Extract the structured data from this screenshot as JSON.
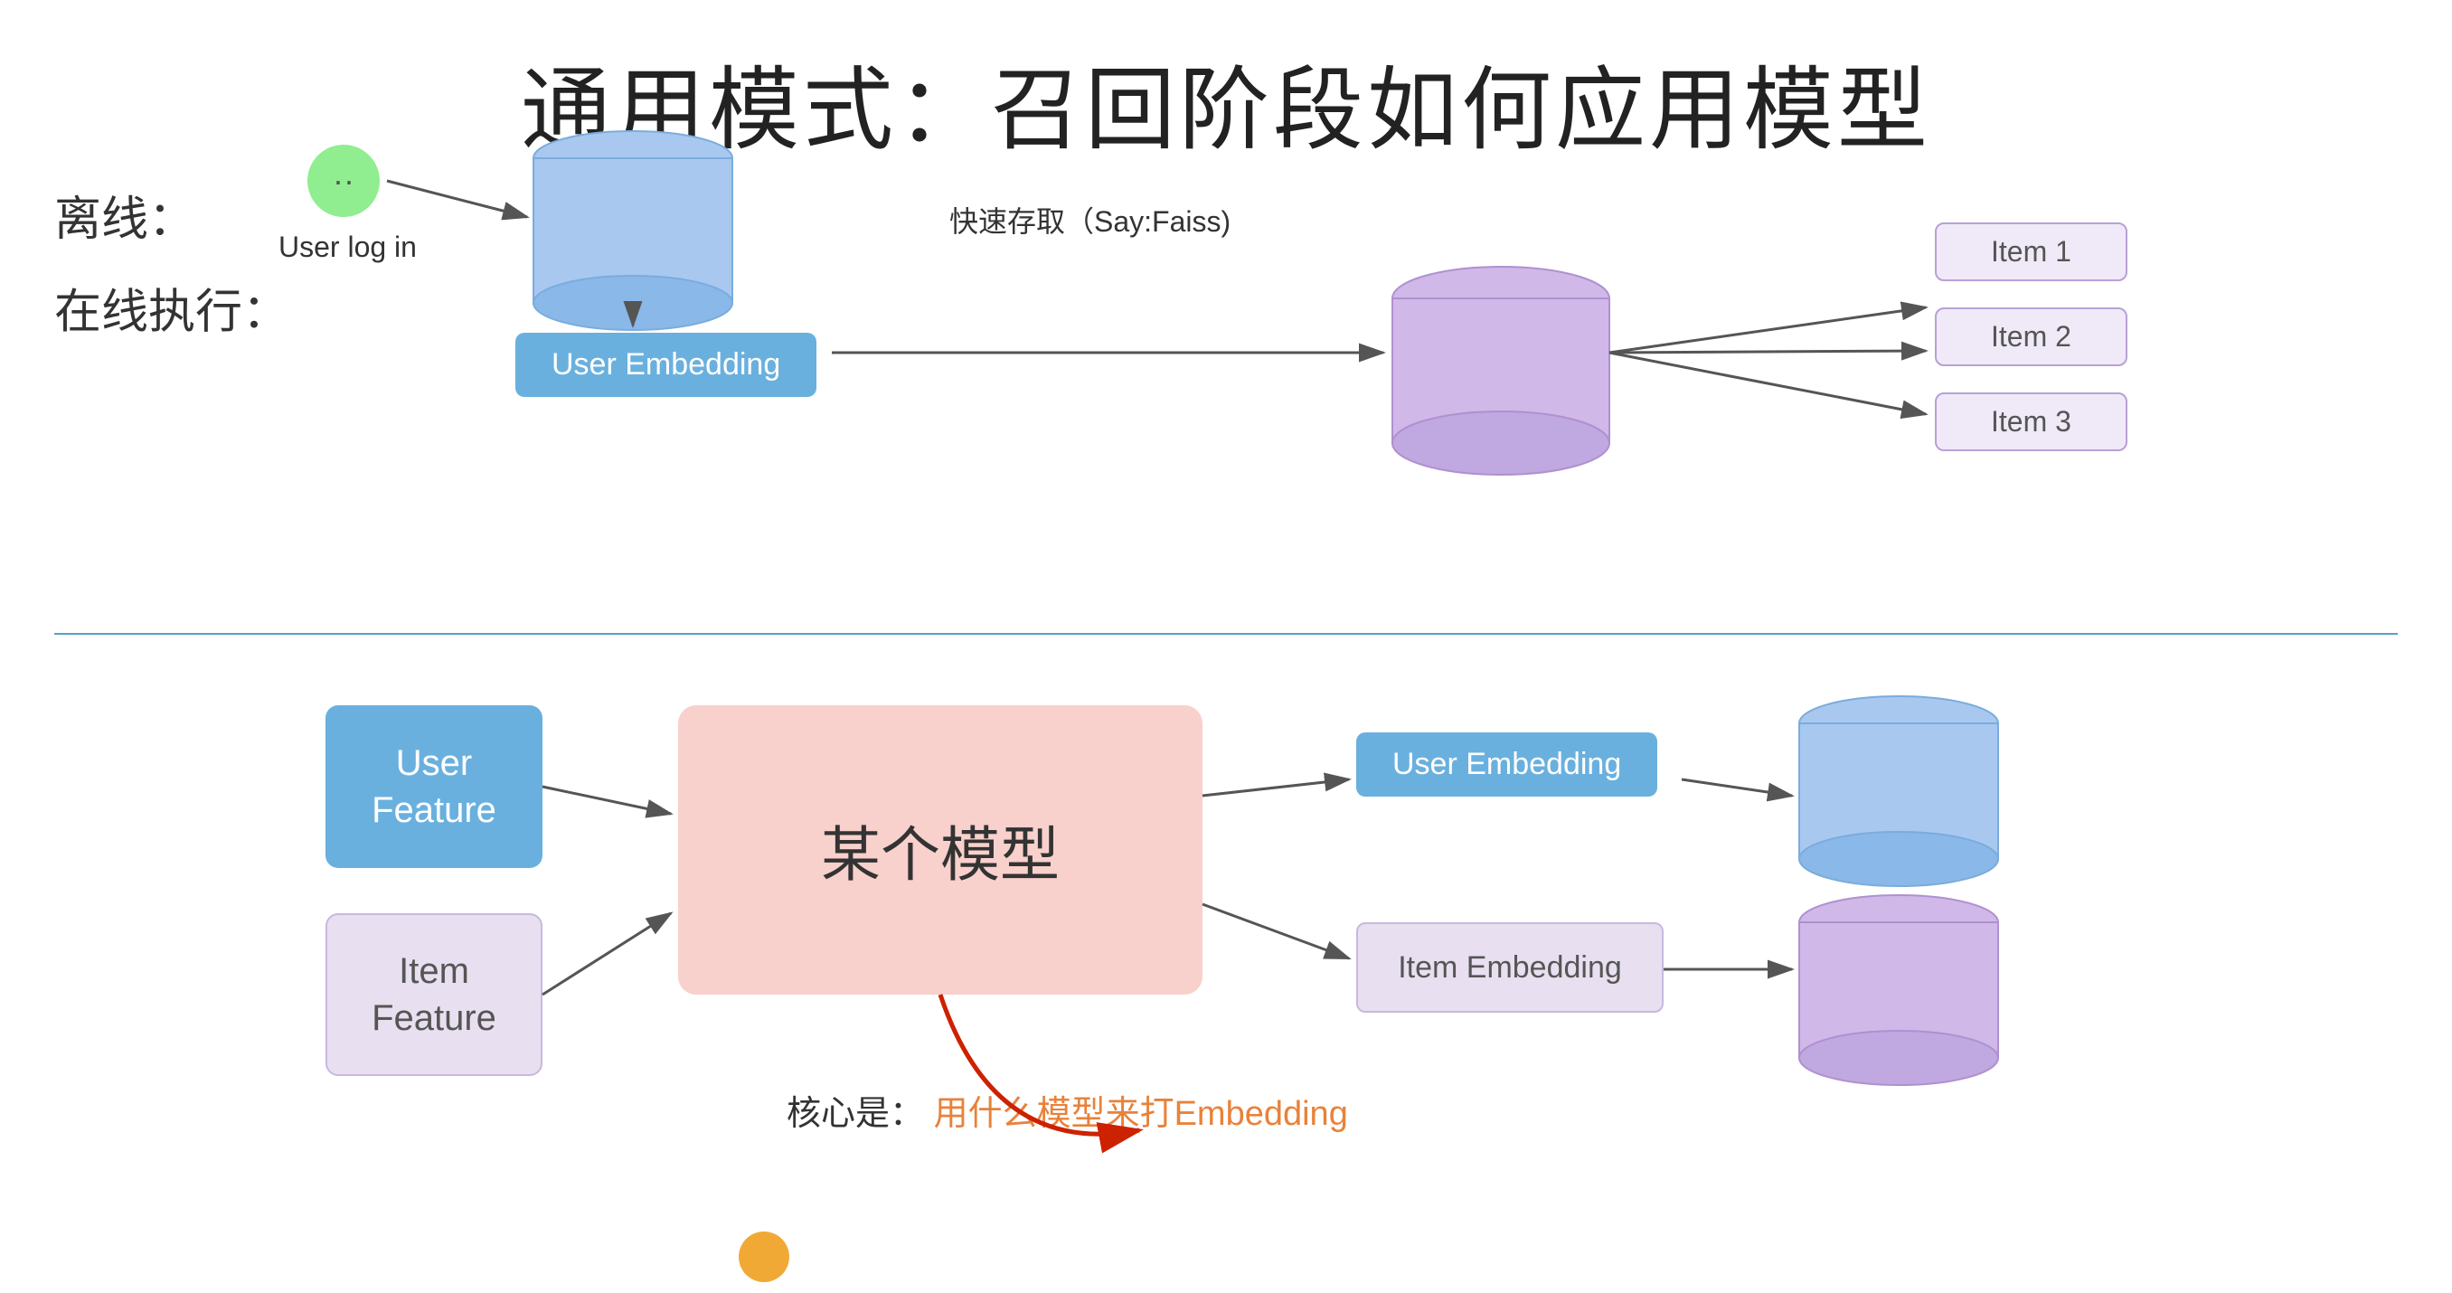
{
  "title": "通用模式：召回阶段如何应用模型",
  "online_label": "在线执行：",
  "offline_label": "离线：",
  "user_login": "User log in",
  "user_embedding": "User Embedding",
  "faiss_label": "快速存取（Say:Faiss)",
  "item1": "Item 1",
  "item2": "Item 2",
  "item3": "Item 3",
  "user_feature": "User\nFeature",
  "item_feature": "Item\nFeature",
  "model_label": "某个模型",
  "user_embedding_bottom": "User Embedding",
  "item_embedding": "Item Embedding",
  "core_text_1": "核心是：",
  "core_text_2": "用什么模型来打Embedding"
}
